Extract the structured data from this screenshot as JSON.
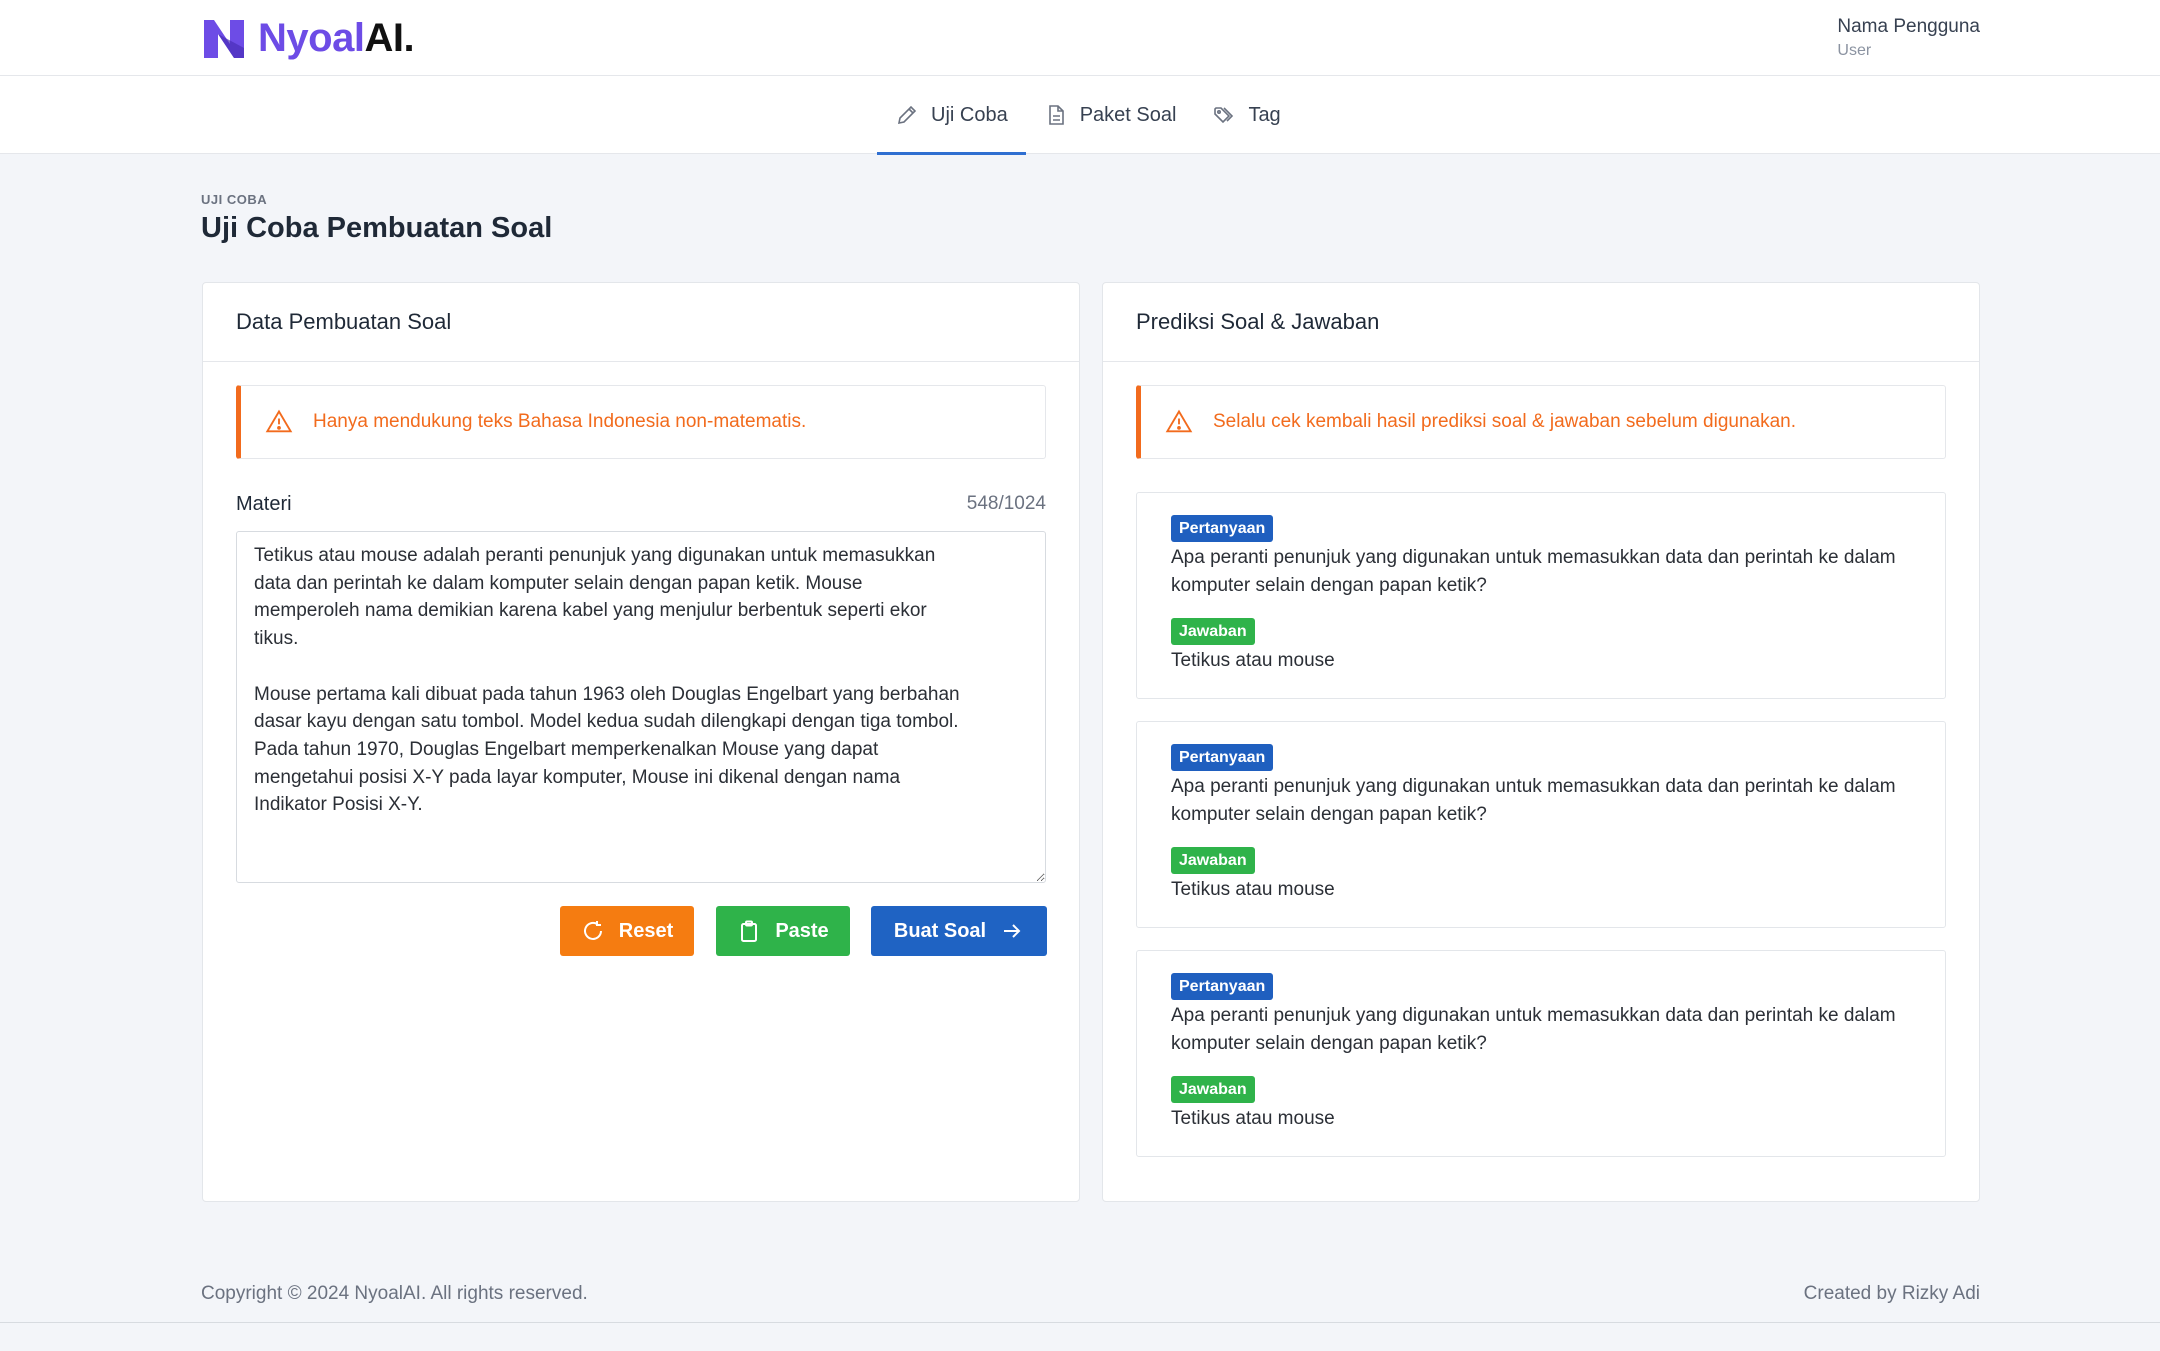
{
  "app": {
    "logo_part1": "Nyoal",
    "logo_part2": "AI.",
    "brand_color": "#6d4ce6"
  },
  "user": {
    "name": "Nama Pengguna",
    "role": "User"
  },
  "tabs": [
    {
      "label": "Uji Coba",
      "icon": "pencil-icon",
      "active": true
    },
    {
      "label": "Paket Soal",
      "icon": "document-icon",
      "active": false
    },
    {
      "label": "Tag",
      "icon": "tags-icon",
      "active": false
    }
  ],
  "page": {
    "breadcrumb": "UJI COBA",
    "title": "Uji Coba Pembuatan Soal"
  },
  "left_card": {
    "title": "Data Pembuatan Soal",
    "alert": "Hanya mendukung teks Bahasa Indonesia non-matematis.",
    "field_label": "Materi",
    "counter": "548/1024",
    "materi_text": "Tetikus atau mouse adalah peranti penunjuk yang digunakan untuk memasukkan\ndata dan perintah ke dalam komputer selain dengan papan ketik. Mouse\nmemperoleh nama demikian karena kabel yang menjulur berbentuk seperti ekor\ntikus.\n\nMouse pertama kali dibuat pada tahun 1963 oleh Douglas Engelbart yang berbahan\ndasar kayu dengan satu tombol. Model kedua sudah dilengkapi dengan tiga tombol.\nPada tahun 1970, Douglas Engelbart memperkenalkan Mouse yang dapat\nmengetahui posisi X-Y pada layar komputer, Mouse ini dikenal dengan nama\nIndikator Posisi X-Y.",
    "buttons": {
      "reset": "Reset",
      "paste": "Paste",
      "buat": "Buat Soal"
    }
  },
  "right_card": {
    "title": "Prediksi Soal & Jawaban",
    "alert": "Selalu cek kembali hasil prediksi soal & jawaban sebelum digunakan.",
    "items": [
      {
        "q_badge": "Pertanyaan",
        "question": "Apa peranti penunjuk yang digunakan untuk memasukkan data dan perintah ke dalam komputer selain dengan papan ketik?",
        "a_badge": "Jawaban",
        "answer": "Tetikus atau mouse"
      },
      {
        "q_badge": "Pertanyaan",
        "question": "Apa peranti penunjuk yang digunakan untuk memasukkan data dan perintah ke dalam komputer selain dengan papan ketik?",
        "a_badge": "Jawaban",
        "answer": "Tetikus atau mouse"
      },
      {
        "q_badge": "Pertanyaan",
        "question": "Apa peranti penunjuk yang digunakan untuk memasukkan data dan perintah ke dalam komputer selain dengan papan ketik?",
        "a_badge": "Jawaban",
        "answer": "Tetikus atau mouse"
      }
    ]
  },
  "footer": {
    "copyright": "Copyright © 2024 NyoalAI. All rights reserved.",
    "credit": "Created by Rizky Adi"
  },
  "colors": {
    "warning": "#f26b1d",
    "reset_button": "#f57c11",
    "paste_button": "#2fb34a",
    "primary_button": "#1f63c3",
    "active_tab": "#2f6fd1"
  }
}
